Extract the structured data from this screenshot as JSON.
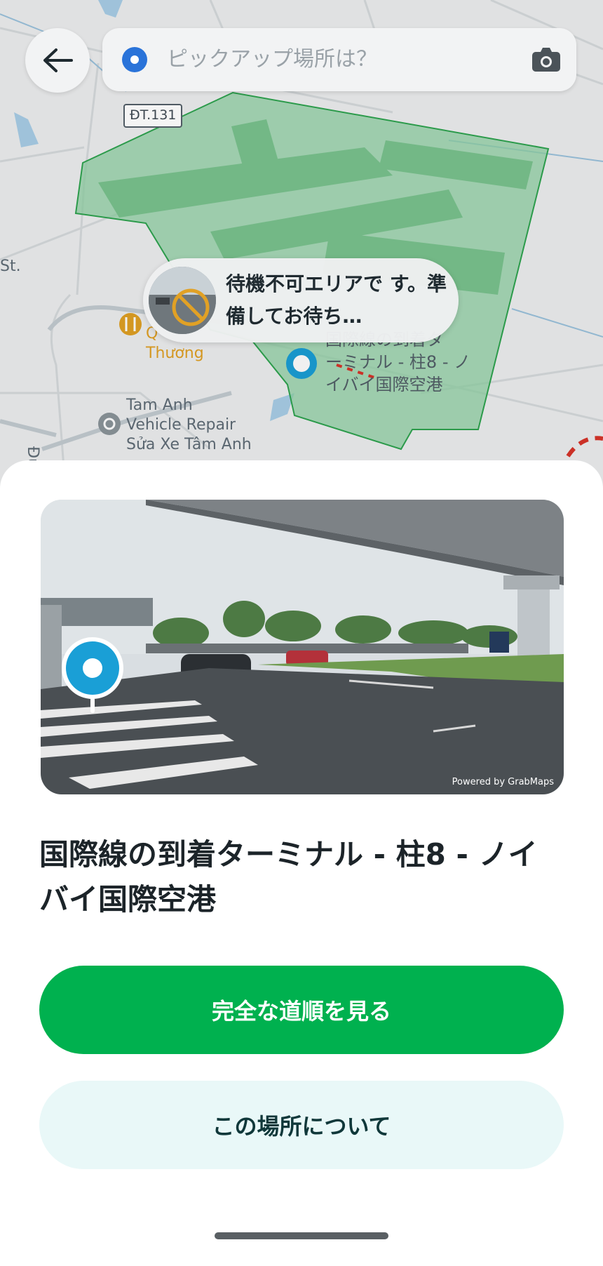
{
  "map": {
    "road_label": "ĐT.131",
    "poi_label": "Thương",
    "poi_label_prefix": "Q",
    "repair_shop": {
      "line1": "Tam Anh",
      "line2": "Vehicle Repair",
      "line3": "Sửa Xe Tâm Anh"
    },
    "street_fragment": "Đườn",
    "st_fragment": "St.",
    "pickup_pin_label": {
      "line1": "国際線の到着タ",
      "line2": "ーミナル - 柱8 - ノ",
      "line3": "イバイ国際空港"
    },
    "zone_color": "#2ea44f"
  },
  "header": {
    "back_icon": "arrow-left-icon",
    "search_placeholder": "ピックアップ場所は？",
    "camera_icon": "camera-icon"
  },
  "toast": {
    "message": "待機不可エリアで す。準備してお待ち…",
    "icon": "no-entry-icon"
  },
  "sheet": {
    "photo_credit": "Powered by GrabMaps",
    "place_name": "国際線の到着ターミナル - 柱8 - ノイバイ国際空港",
    "primary_button": "完全な道順を見る",
    "secondary_button": "この場所について"
  },
  "colors": {
    "primary": "#00b14f",
    "secondary_bg": "#e9f8f8",
    "pin_blue": "#1a9fd6"
  }
}
